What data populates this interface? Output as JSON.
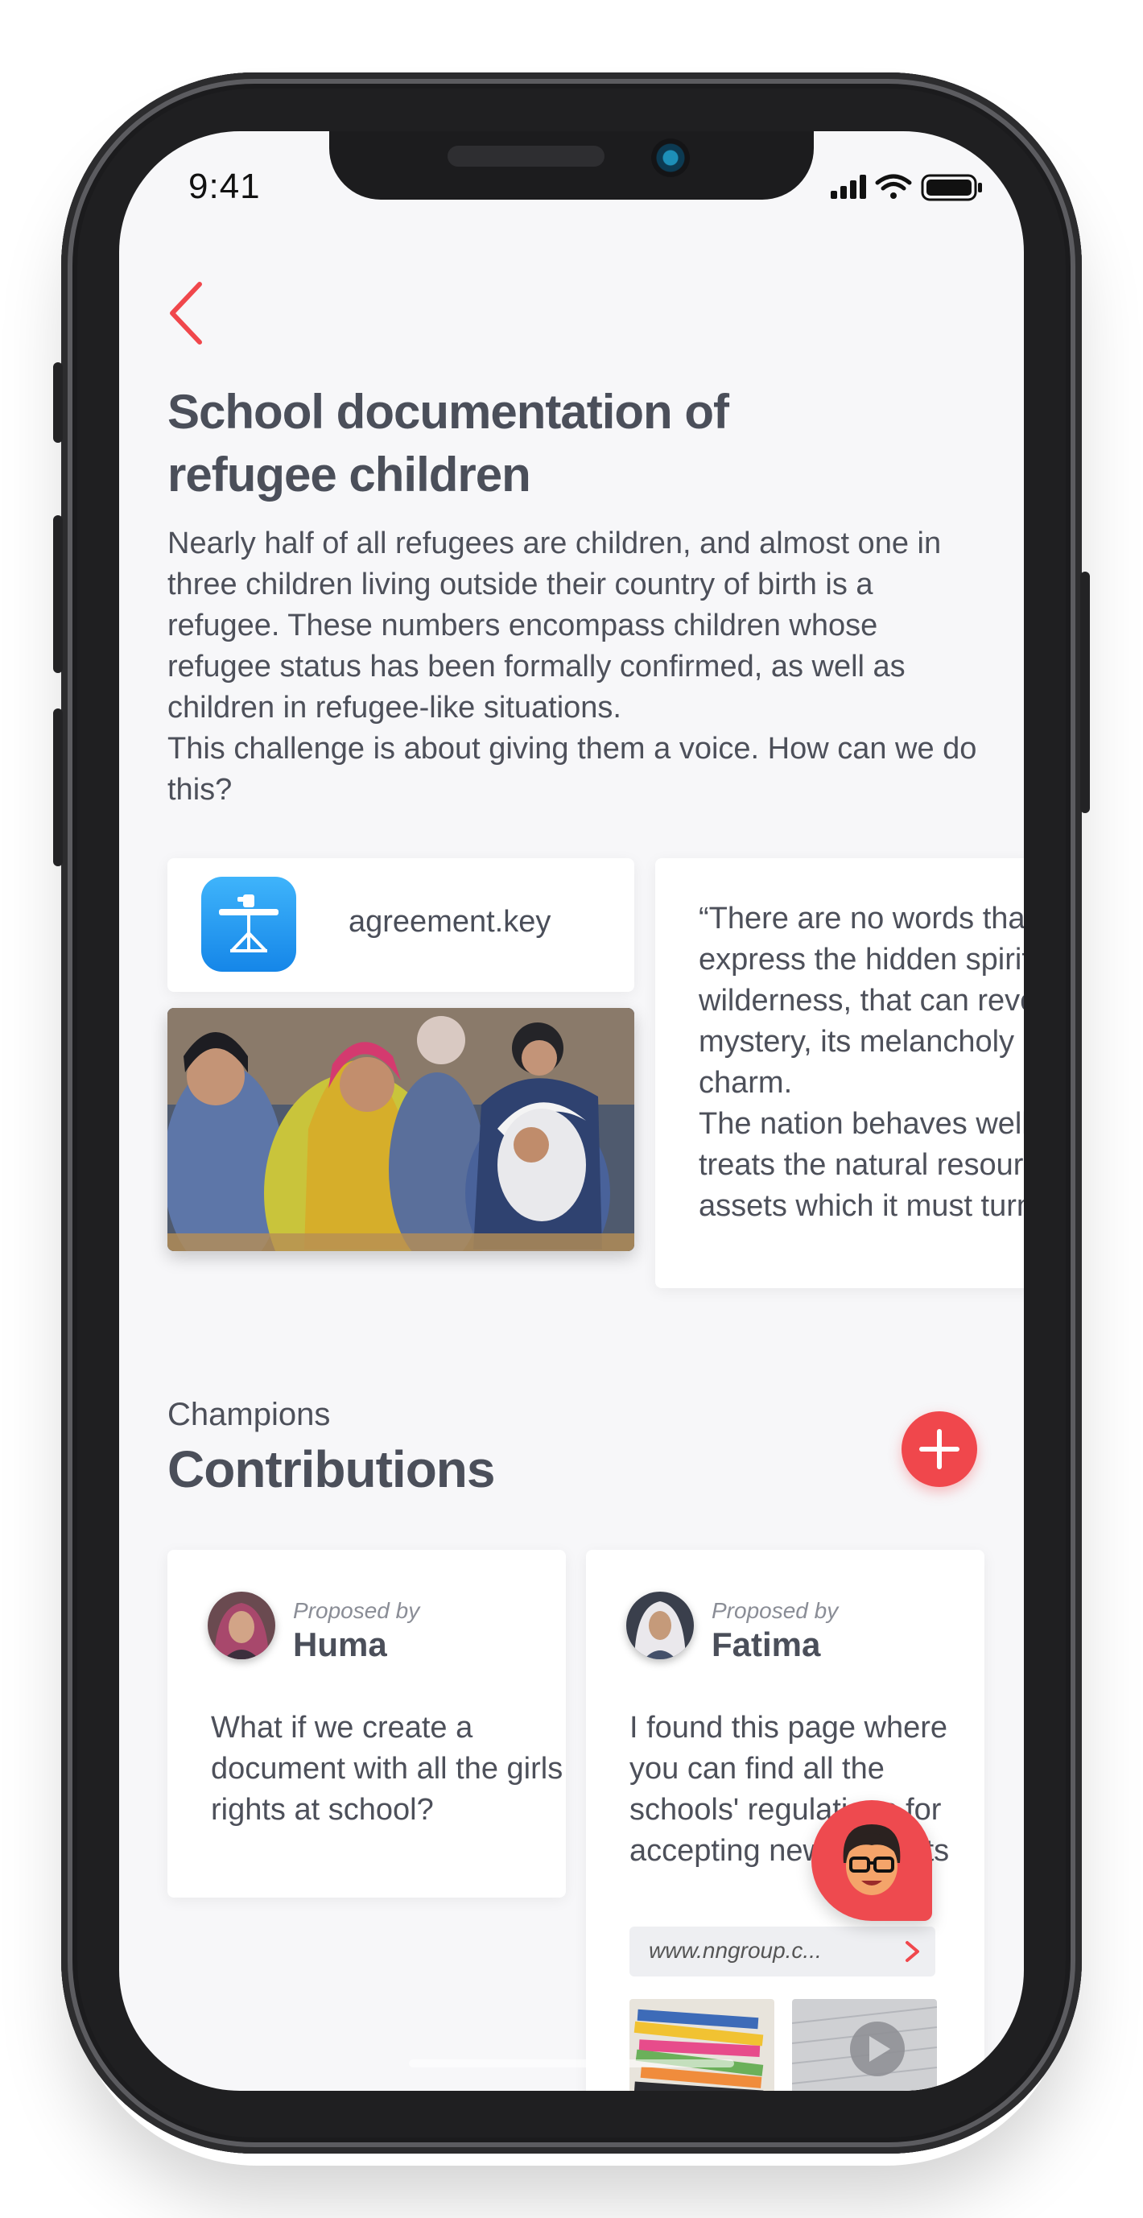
{
  "status_bar": {
    "time": "9:41"
  },
  "header": {
    "back_label": "",
    "title": "School documentation of refugee children",
    "description_p1": "Nearly half of all refugees are children, and almost one in three children living outside their country of birth is a refugee. These numbers encompass children whose refugee status has been formally confirmed, as well as children in refugee-like situations.",
    "description_p2": "This challenge is about giving them a voice. How can we do this?"
  },
  "attachments": {
    "file": {
      "name": "agreement.key",
      "icon": "keynote-icon"
    },
    "quote": "“There are no words that can express the hidden spirit of the wilderness, that can reveal its mystery, its melancholy and its charm.\nThe nation behaves well if it treats the natural resources as assets which it must turn over"
  },
  "contributions": {
    "label": "Champions",
    "title": "Contributions",
    "add_icon": "plus-icon",
    "items": [
      {
        "proposed_label": "Proposed by",
        "author": "Huma",
        "text": "What if we create a document with all the girls rights at school?"
      },
      {
        "proposed_label": "Proposed by",
        "author": "Fatima",
        "text": "I found this page where you can find all the schools' regulations for accepting new students",
        "link": "www.nngroup.c..."
      }
    ]
  },
  "colors": {
    "accent": "#f0474c",
    "text": "#4b4f5a",
    "background": "#f7f7f9"
  }
}
